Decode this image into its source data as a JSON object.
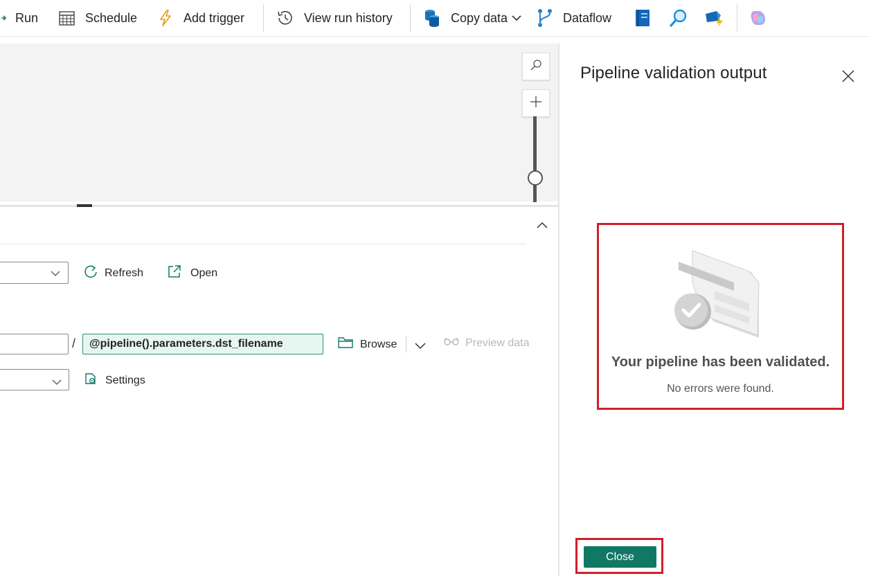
{
  "toolbar": {
    "run_label": "Run",
    "schedule_label": "Schedule",
    "add_trigger_label": "Add trigger",
    "view_run_history_label": "View run history",
    "copy_data_label": "Copy data",
    "dataflow_label": "Dataflow",
    "icons": [
      "run-icon",
      "schedule-icon",
      "trigger-icon",
      "history-icon",
      "copy-data-icon",
      "chevron-down-icon",
      "dataflow-icon",
      "notebook-icon",
      "search-icon",
      "eventstream-icon",
      "copilot-icon"
    ]
  },
  "properties": {
    "refresh_label": "Refresh",
    "open_label": "Open",
    "path_separator": "/",
    "file_name_value": "@pipeline().parameters.dst_filename",
    "browse_label": "Browse",
    "preview_data_label": "Preview data",
    "settings_label": "Settings"
  },
  "validation_panel": {
    "title": "Pipeline validation output",
    "result_title": "Your pipeline has been validated.",
    "result_subtitle": "No errors were found.",
    "close_button_label": "Close"
  },
  "colors": {
    "accent": "#117865",
    "highlight": "#d11f2a",
    "expression_bg": "#e6f6f1"
  }
}
